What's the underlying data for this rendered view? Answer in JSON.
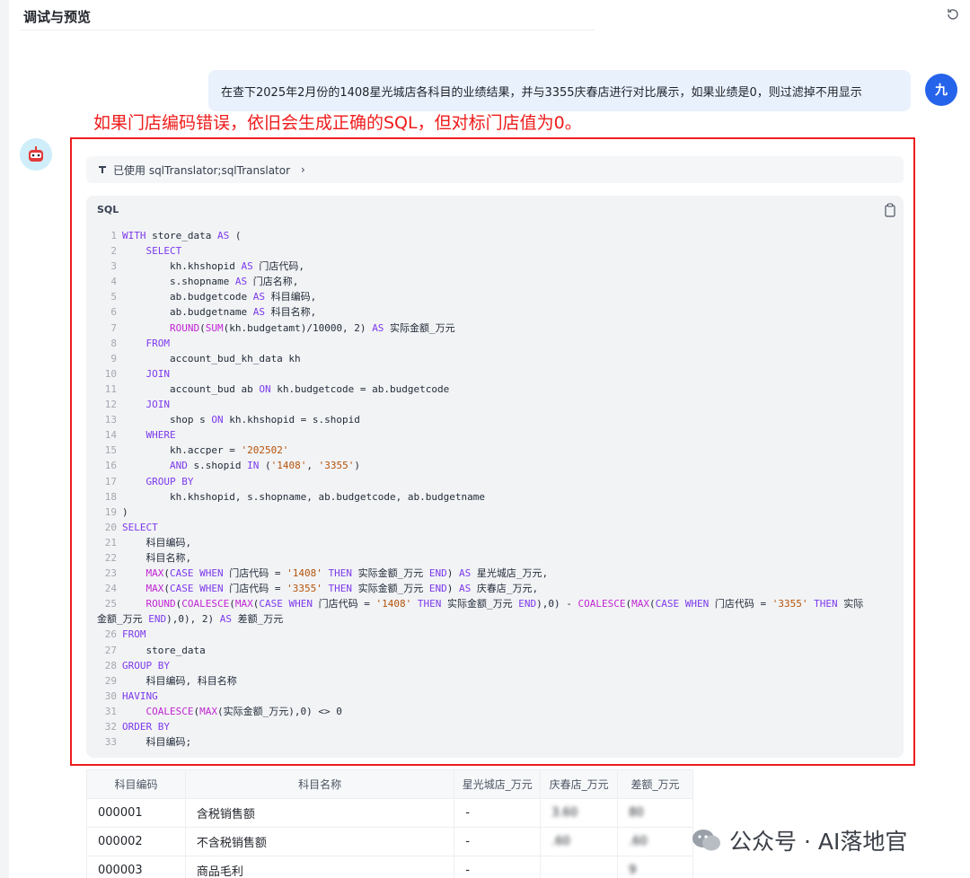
{
  "header": {
    "title": "调试与预览"
  },
  "user_message": "在查下2025年2月份的1408星光城店各科目的业绩结果，并与3355庆春店进行对比展示，如果业绩是0，则过滤掉不用显示",
  "user_avatar": "九",
  "annotation": "如果门店编码错误，依旧会生成正确的SQL，但对标门店值为0。",
  "tool_row": {
    "label": "已使用 sqlTranslator;sqlTranslator"
  },
  "code": {
    "language": "SQL",
    "lines": [
      {
        "n": "1",
        "t": "WITH store_data AS ("
      },
      {
        "n": "2",
        "t": "    SELECT"
      },
      {
        "n": "3",
        "t": "        kh.khshopid AS 门店代码,"
      },
      {
        "n": "4",
        "t": "        s.shopname AS 门店名称,"
      },
      {
        "n": "5",
        "t": "        ab.budgetcode AS 科目编码,"
      },
      {
        "n": "6",
        "t": "        ab.budgetname AS 科目名称,"
      },
      {
        "n": "7",
        "t": "        ROUND(SUM(kh.budgetamt)/10000, 2) AS 实际金额_万元"
      },
      {
        "n": "8",
        "t": "    FROM"
      },
      {
        "n": "9",
        "t": "        account_bud_kh_data kh"
      },
      {
        "n": "10",
        "t": "    JOIN"
      },
      {
        "n": "11",
        "t": "        account_bud ab ON kh.budgetcode = ab.budgetcode"
      },
      {
        "n": "12",
        "t": "    JOIN"
      },
      {
        "n": "13",
        "t": "        shop s ON kh.khshopid = s.shopid"
      },
      {
        "n": "14",
        "t": "    WHERE"
      },
      {
        "n": "15",
        "t": "        kh.accper = '202502'"
      },
      {
        "n": "16",
        "t": "        AND s.shopid IN ('1408', '3355')"
      },
      {
        "n": "17",
        "t": "    GROUP BY"
      },
      {
        "n": "18",
        "t": "        kh.khshopid, s.shopname, ab.budgetcode, ab.budgetname"
      },
      {
        "n": "19",
        "t": ")"
      },
      {
        "n": "20",
        "t": "SELECT"
      },
      {
        "n": "21",
        "t": "    科目编码,"
      },
      {
        "n": "22",
        "t": "    科目名称,"
      },
      {
        "n": "23",
        "t": "    MAX(CASE WHEN 门店代码 = '1408' THEN 实际金额_万元 END) AS 星光城店_万元,"
      },
      {
        "n": "24",
        "t": "    MAX(CASE WHEN 门店代码 = '3355' THEN 实际金额_万元 END) AS 庆春店_万元,"
      },
      {
        "n": "25",
        "t": "    ROUND(COALESCE(MAX(CASE WHEN 门店代码 = '1408' THEN 实际金额_万元 END),0) - COALESCE(MAX(CASE WHEN 门店代码 = '3355' THEN 实际"
      },
      {
        "n": "",
        "t": "金额_万元 END),0), 2) AS 差额_万元"
      },
      {
        "n": "26",
        "t": "FROM"
      },
      {
        "n": "27",
        "t": "    store_data"
      },
      {
        "n": "28",
        "t": "GROUP BY"
      },
      {
        "n": "29",
        "t": "    科目编码, 科目名称"
      },
      {
        "n": "30",
        "t": "HAVING"
      },
      {
        "n": "31",
        "t": "    COALESCE(MAX(实际金额_万元),0) <> 0"
      },
      {
        "n": "32",
        "t": "ORDER BY"
      },
      {
        "n": "33",
        "t": "    科目编码;"
      }
    ]
  },
  "table": {
    "headers": [
      "科目编码",
      "科目名称",
      "星光城店_万元",
      "庆春店_万元",
      "差额_万元"
    ],
    "rows": [
      [
        "000001",
        "含税销售额",
        "-",
        "3.60",
        "80"
      ],
      [
        "000002",
        "不含税销售额",
        "-",
        ".60",
        ".60"
      ],
      [
        "000003",
        "商品毛利",
        "-",
        "",
        "9"
      ]
    ]
  },
  "watermark": "公众号 · AI落地官",
  "colors": {
    "annotation_red": "#ee1d1d",
    "user_bubble": "#e9f1fd",
    "avatar_blue": "#2563eb",
    "keyword": "#7c3aed"
  }
}
